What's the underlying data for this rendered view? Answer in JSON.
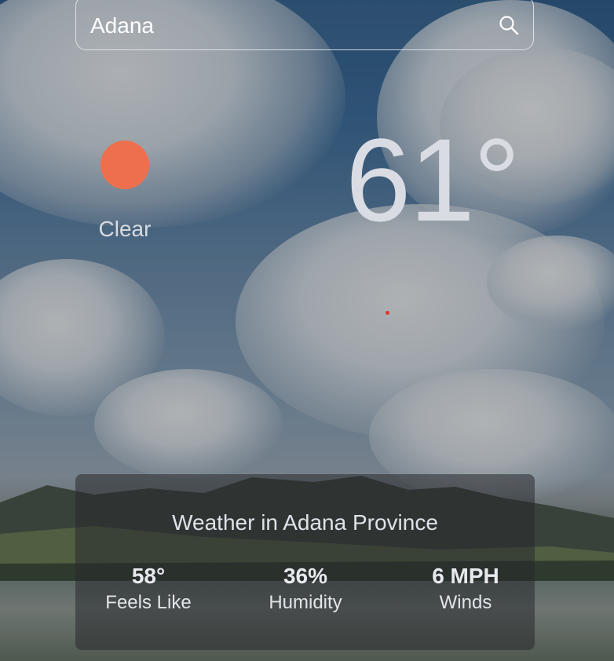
{
  "search": {
    "value": "Adana",
    "icon": "search-icon"
  },
  "current": {
    "condition": "Clear",
    "condition_icon": "sun-icon",
    "condition_color": "#ee6f4d",
    "temperature": "61°"
  },
  "details": {
    "title": "Weather in Adana Province",
    "feels_like": {
      "value": "58°",
      "label": "Feels Like"
    },
    "humidity": {
      "value": "36%",
      "label": "Humidity"
    },
    "winds": {
      "value": "6 MPH",
      "label": "Winds"
    }
  }
}
